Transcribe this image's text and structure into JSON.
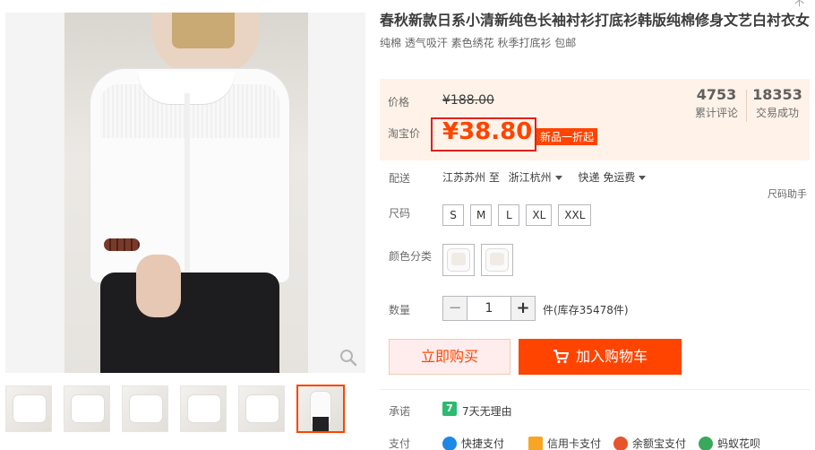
{
  "top_fragment": "不",
  "product": {
    "title": "春秋新款日系小清新纯色长袖衬衫打底衫韩版纯棉修身文艺白衬衣女",
    "subtitle": "纯棉 透气吸汗 素色绣花 秋季打底衫 包邮"
  },
  "price": {
    "label": "价格",
    "original": "¥188.00",
    "promo_label": "淘宝价",
    "promo": "¥38.80",
    "promo_tag": "新品一折起"
  },
  "stats": {
    "reviews_count": "4753",
    "reviews_label": "累计评论",
    "sales_count": "18353",
    "sales_label": "交易成功"
  },
  "shipping": {
    "label": "配送",
    "from": "江苏苏州 至",
    "to": "浙江杭州",
    "method": "快递 免运费"
  },
  "size_helper": "尺码助手",
  "sizes": {
    "label": "尺码",
    "options": [
      "S",
      "M",
      "L",
      "XL",
      "XXL"
    ]
  },
  "colors": {
    "label": "颜色分类",
    "count": 2
  },
  "quantity": {
    "label": "数量",
    "value": "1",
    "minus": "−",
    "plus": "+",
    "stock": "件(库存35478件)"
  },
  "actions": {
    "buy_now": "立即购买",
    "add_cart": "加入购物车"
  },
  "promise": {
    "label": "承诺",
    "badge": "7",
    "text": "7天无理由"
  },
  "payment": {
    "label": "支付",
    "methods": [
      "快捷支付",
      "信用卡支付",
      "余额宝支付",
      "蚂蚁花呗"
    ]
  },
  "colors_theme": {
    "accent": "#ff4400",
    "price_bg": "#fff2e8",
    "promo_border": "#e02020"
  }
}
